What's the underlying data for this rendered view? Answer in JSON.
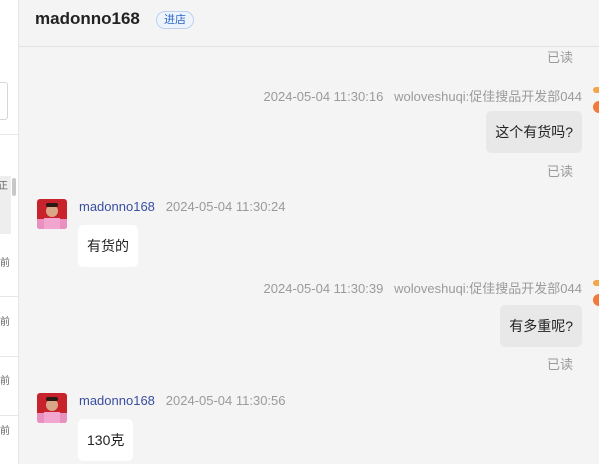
{
  "header": {
    "contact_name": "madonno168",
    "store_badge": "进店"
  },
  "left_strip": {
    "active_item_text": "正",
    "item_times": [
      "前",
      "前",
      "前",
      "前"
    ]
  },
  "messages": [
    {
      "type": "status",
      "text": "已读"
    },
    {
      "type": "outgoing",
      "timestamp": "2024-05-04 11:30:16",
      "sender": "woloveshuqi:促佳搜品开发部044",
      "text": "这个有货吗?",
      "status": "已读"
    },
    {
      "type": "incoming",
      "sender": "madonno168",
      "timestamp": "2024-05-04 11:30:24",
      "text": "有货的"
    },
    {
      "type": "outgoing",
      "timestamp": "2024-05-04 11:30:39",
      "sender": "woloveshuqi:促佳搜品开发部044",
      "text": "有多重呢?",
      "status": "已读"
    },
    {
      "type": "incoming",
      "sender": "madonno168",
      "timestamp": "2024-05-04 11:30:56",
      "text": "130克"
    }
  ],
  "colors": {
    "background": "#f4f4f4",
    "outgoing_bubble": "#e8e8e8",
    "incoming_bubble": "#ffffff",
    "sender_link": "#3a4ea0",
    "badge": "#2a66c4",
    "side_marker": "#f07a3c"
  }
}
